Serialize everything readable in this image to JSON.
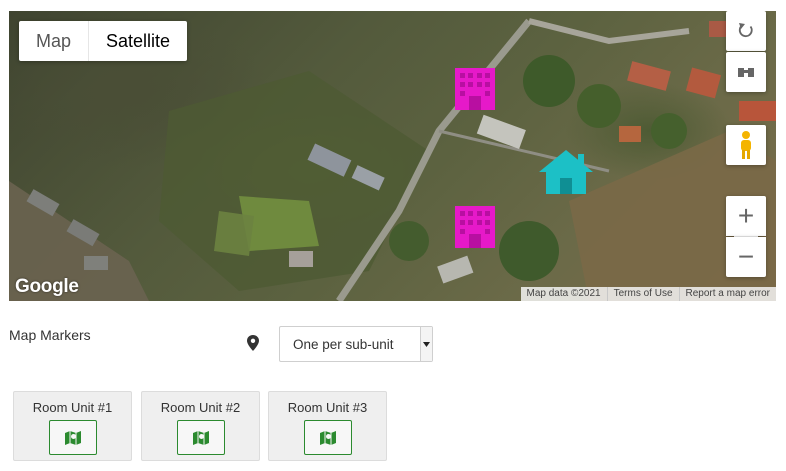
{
  "map": {
    "type_options": [
      {
        "label": "Map",
        "active": false
      },
      {
        "label": "Satellite",
        "active": true
      }
    ],
    "logo_text": "Google",
    "attribution": [
      "Map data ©2021",
      "Terms of Use",
      "Report a map error"
    ],
    "controls": {
      "rotate_icon": "rotate-icon",
      "tilt_icon": "tilt-icon",
      "pegman_icon": "pegman-icon",
      "zoom_in": "+",
      "zoom_out": "−"
    },
    "markers": [
      {
        "icon": "building-icon",
        "color": "#e619c9"
      },
      {
        "icon": "building-icon",
        "color": "#e619c9"
      },
      {
        "icon": "house-icon",
        "color": "#1cc0c6"
      }
    ]
  },
  "settings": {
    "label": "Map Markers",
    "pin_icon": "map-pin-icon",
    "select_value": "One per sub-unit"
  },
  "units": [
    {
      "label": "Room Unit #1",
      "icon": "map-icon",
      "color": "#2b8a2f"
    },
    {
      "label": "Room Unit #2",
      "icon": "map-icon",
      "color": "#2b8a2f"
    },
    {
      "label": "Room Unit #3",
      "icon": "map-icon",
      "color": "#2b8a2f"
    }
  ]
}
